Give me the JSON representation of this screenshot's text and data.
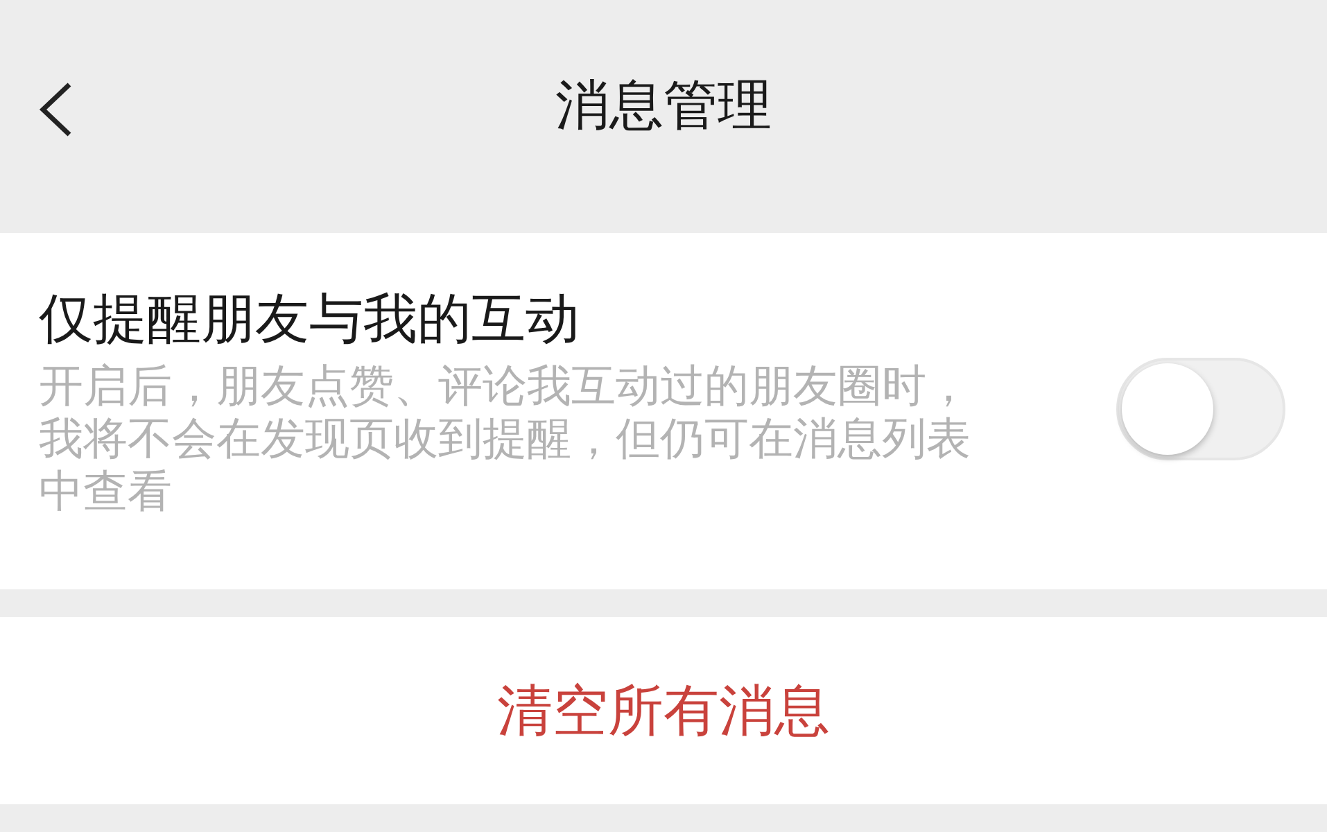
{
  "header": {
    "title": "消息管理"
  },
  "setting": {
    "title": "仅提醒朋友与我的互动",
    "description": "开启后，朋友点赞、评论我互动过的朋友圈时，我将不会在发现页收到提醒，但仍可在消息列表中查看",
    "on": false
  },
  "action": {
    "label": "清空所有消息"
  }
}
